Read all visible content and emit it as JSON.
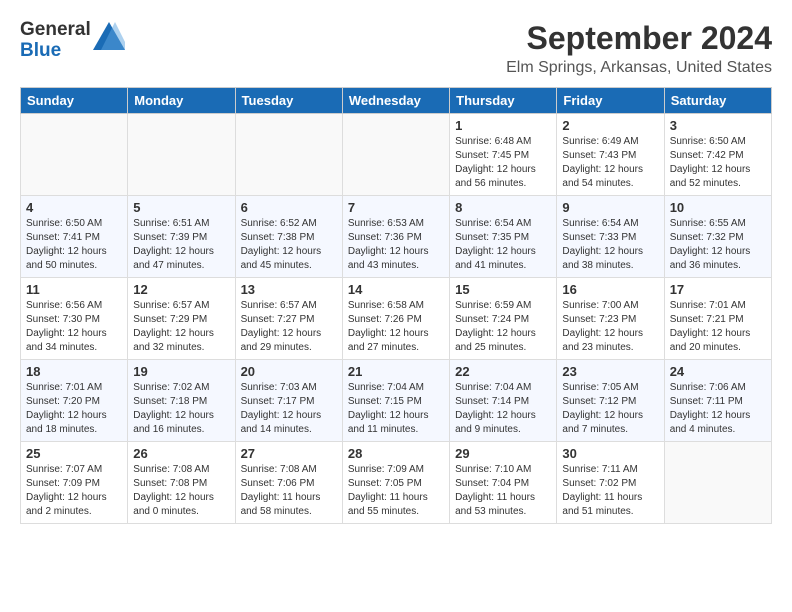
{
  "header": {
    "logo_line1": "General",
    "logo_line2": "Blue",
    "title": "September 2024",
    "subtitle": "Elm Springs, Arkansas, United States"
  },
  "calendar": {
    "headers": [
      "Sunday",
      "Monday",
      "Tuesday",
      "Wednesday",
      "Thursday",
      "Friday",
      "Saturday"
    ],
    "weeks": [
      [
        null,
        null,
        null,
        null,
        {
          "day": 1,
          "sunrise": "6:48 AM",
          "sunset": "7:45 PM",
          "daylight": "12 hours and 56 minutes."
        },
        {
          "day": 2,
          "sunrise": "6:49 AM",
          "sunset": "7:43 PM",
          "daylight": "12 hours and 54 minutes."
        },
        {
          "day": 3,
          "sunrise": "6:50 AM",
          "sunset": "7:42 PM",
          "daylight": "12 hours and 52 minutes."
        },
        {
          "day": 4,
          "sunrise": "6:50 AM",
          "sunset": "7:41 PM",
          "daylight": "12 hours and 50 minutes."
        },
        {
          "day": 5,
          "sunrise": "6:51 AM",
          "sunset": "7:39 PM",
          "daylight": "12 hours and 47 minutes."
        },
        {
          "day": 6,
          "sunrise": "6:52 AM",
          "sunset": "7:38 PM",
          "daylight": "12 hours and 45 minutes."
        },
        {
          "day": 7,
          "sunrise": "6:53 AM",
          "sunset": "7:36 PM",
          "daylight": "12 hours and 43 minutes."
        }
      ],
      [
        {
          "day": 8,
          "sunrise": "6:54 AM",
          "sunset": "7:35 PM",
          "daylight": "12 hours and 41 minutes."
        },
        {
          "day": 9,
          "sunrise": "6:54 AM",
          "sunset": "7:33 PM",
          "daylight": "12 hours and 38 minutes."
        },
        {
          "day": 10,
          "sunrise": "6:55 AM",
          "sunset": "7:32 PM",
          "daylight": "12 hours and 36 minutes."
        },
        {
          "day": 11,
          "sunrise": "6:56 AM",
          "sunset": "7:30 PM",
          "daylight": "12 hours and 34 minutes."
        },
        {
          "day": 12,
          "sunrise": "6:57 AM",
          "sunset": "7:29 PM",
          "daylight": "12 hours and 32 minutes."
        },
        {
          "day": 13,
          "sunrise": "6:57 AM",
          "sunset": "7:27 PM",
          "daylight": "12 hours and 29 minutes."
        },
        {
          "day": 14,
          "sunrise": "6:58 AM",
          "sunset": "7:26 PM",
          "daylight": "12 hours and 27 minutes."
        }
      ],
      [
        {
          "day": 15,
          "sunrise": "6:59 AM",
          "sunset": "7:24 PM",
          "daylight": "12 hours and 25 minutes."
        },
        {
          "day": 16,
          "sunrise": "7:00 AM",
          "sunset": "7:23 PM",
          "daylight": "12 hours and 23 minutes."
        },
        {
          "day": 17,
          "sunrise": "7:01 AM",
          "sunset": "7:21 PM",
          "daylight": "12 hours and 20 minutes."
        },
        {
          "day": 18,
          "sunrise": "7:01 AM",
          "sunset": "7:20 PM",
          "daylight": "12 hours and 18 minutes."
        },
        {
          "day": 19,
          "sunrise": "7:02 AM",
          "sunset": "7:18 PM",
          "daylight": "12 hours and 16 minutes."
        },
        {
          "day": 20,
          "sunrise": "7:03 AM",
          "sunset": "7:17 PM",
          "daylight": "12 hours and 14 minutes."
        },
        {
          "day": 21,
          "sunrise": "7:04 AM",
          "sunset": "7:15 PM",
          "daylight": "12 hours and 11 minutes."
        }
      ],
      [
        {
          "day": 22,
          "sunrise": "7:04 AM",
          "sunset": "7:14 PM",
          "daylight": "12 hours and 9 minutes."
        },
        {
          "day": 23,
          "sunrise": "7:05 AM",
          "sunset": "7:12 PM",
          "daylight": "12 hours and 7 minutes."
        },
        {
          "day": 24,
          "sunrise": "7:06 AM",
          "sunset": "7:11 PM",
          "daylight": "12 hours and 4 minutes."
        },
        {
          "day": 25,
          "sunrise": "7:07 AM",
          "sunset": "7:09 PM",
          "daylight": "12 hours and 2 minutes."
        },
        {
          "day": 26,
          "sunrise": "7:08 AM",
          "sunset": "7:08 PM",
          "daylight": "12 hours and 0 minutes."
        },
        {
          "day": 27,
          "sunrise": "7:08 AM",
          "sunset": "7:06 PM",
          "daylight": "11 hours and 58 minutes."
        },
        {
          "day": 28,
          "sunrise": "7:09 AM",
          "sunset": "7:05 PM",
          "daylight": "11 hours and 55 minutes."
        }
      ],
      [
        {
          "day": 29,
          "sunrise": "7:10 AM",
          "sunset": "7:04 PM",
          "daylight": "11 hours and 53 minutes."
        },
        {
          "day": 30,
          "sunrise": "7:11 AM",
          "sunset": "7:02 PM",
          "daylight": "11 hours and 51 minutes."
        },
        null,
        null,
        null,
        null,
        null
      ]
    ]
  }
}
